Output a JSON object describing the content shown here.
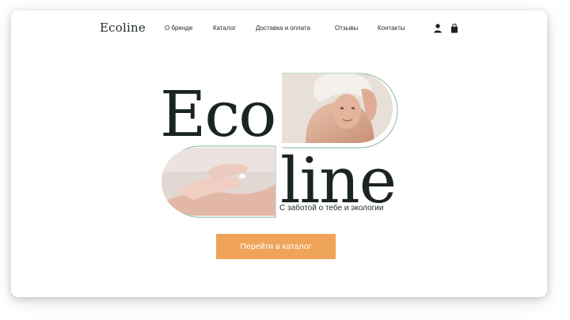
{
  "header": {
    "logo": "Ecoline",
    "nav": [
      {
        "label": "О бренде"
      },
      {
        "label": "Каталог"
      },
      {
        "label": "Доставка и оплата"
      },
      {
        "label": "Отзывы"
      },
      {
        "label": "Контакты"
      }
    ],
    "icons": [
      "user-icon",
      "shopping-bag-icon"
    ]
  },
  "hero": {
    "title_top": "Eco",
    "title_bottom": "line",
    "tagline": "С заботой о тебе и экологии",
    "cta_label": "Перейти в каталог",
    "images": [
      "woman-portrait-photo",
      "hands-cream-photo"
    ]
  },
  "colors": {
    "accent": "#efa45a",
    "text": "#1b241f",
    "outline": "#7fb39a"
  }
}
